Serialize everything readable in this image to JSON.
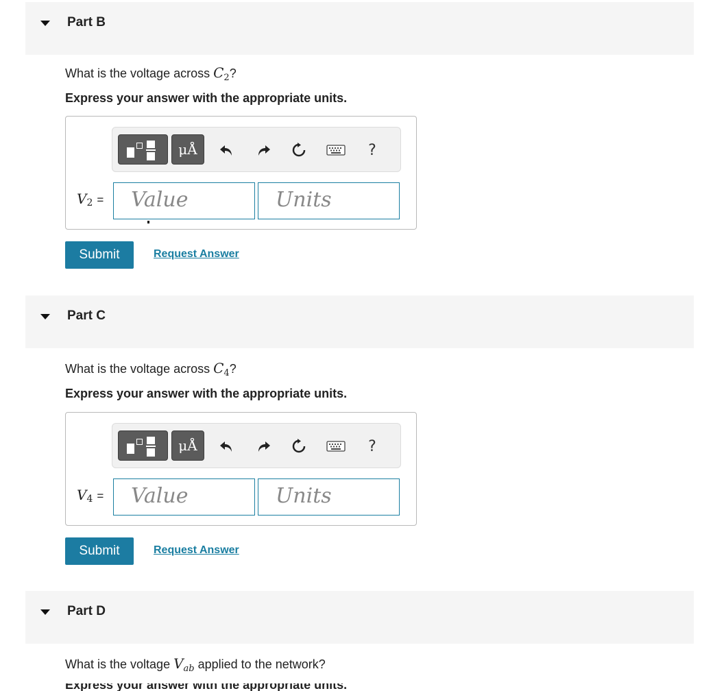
{
  "parts": [
    {
      "title": "Part B",
      "question_prefix": "What is the voltage across ",
      "question_var": "C",
      "question_sub": "2",
      "question_suffix": "?",
      "instruction": "Express your answer with the appropriate units.",
      "var_symbol": "V",
      "var_sub": "2",
      "equals": "=",
      "value_placeholder": "Value",
      "units_placeholder": "Units",
      "submit_label": "Submit",
      "request_label": "Request Answer"
    },
    {
      "title": "Part C",
      "question_prefix": "What is the voltage across ",
      "question_var": "C",
      "question_sub": "4",
      "question_suffix": "?",
      "instruction": "Express your answer with the appropriate units.",
      "var_symbol": "V",
      "var_sub": "4",
      "equals": "=",
      "value_placeholder": "Value",
      "units_placeholder": "Units",
      "submit_label": "Submit",
      "request_label": "Request Answer"
    },
    {
      "title": "Part D",
      "question_prefix": "What is the voltage ",
      "question_var": "V",
      "question_sub": "ab",
      "question_suffix": " applied to the network?",
      "instruction": "Express your answer with the appropriate units."
    }
  ],
  "toolbar": {
    "units_button_label": "μÅ",
    "help_label": "?",
    "icons": [
      "templates-icon",
      "units-icon",
      "undo-icon",
      "redo-icon",
      "reset-icon",
      "keyboard-icon",
      "help-icon"
    ]
  },
  "colors": {
    "accent": "#1c7ca2",
    "link": "#1a7ea1",
    "header_bg": "#f5f5f5",
    "toolbar_button": "#5b5b5b"
  }
}
